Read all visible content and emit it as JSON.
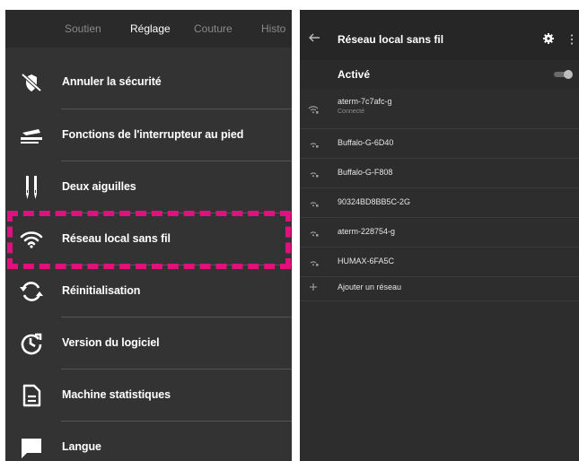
{
  "left": {
    "tabs": [
      {
        "label": "Soutien"
      },
      {
        "label": "Réglage"
      },
      {
        "label": "Couture"
      },
      {
        "label": "Histo"
      }
    ],
    "menu": [
      {
        "label": "Annuler la sécurité",
        "icon": "security-off-icon"
      },
      {
        "label": "Fonctions de l'interrupteur au pied",
        "icon": "foot-switch-icon"
      },
      {
        "label": "Deux aiguilles",
        "icon": "twin-needle-icon"
      },
      {
        "label": "Réseau local sans fil",
        "icon": "wifi-icon"
      },
      {
        "label": "Réinitialisation",
        "icon": "reset-icon"
      },
      {
        "label": "Version du logiciel",
        "icon": "software-version-icon"
      },
      {
        "label": "Machine statistiques",
        "icon": "document-icon"
      },
      {
        "label": "Langue",
        "icon": "chat-bubble-icon"
      }
    ],
    "highlight_color": "#e0107f"
  },
  "right": {
    "title": "Réseau local sans fil",
    "active_label": "Activé",
    "toggle_on": true,
    "networks": [
      {
        "name": "aterm-7c7afc-g",
        "status": "Connecté"
      },
      {
        "name": "Buffalo-G-6D40"
      },
      {
        "name": "Buffalo-G-F808"
      },
      {
        "name": "90324BD8BB5C-2G"
      },
      {
        "name": "aterm-228754-g"
      },
      {
        "name": "HUMAX-6FA5C"
      }
    ],
    "add_network": "Ajouter un réseau"
  }
}
